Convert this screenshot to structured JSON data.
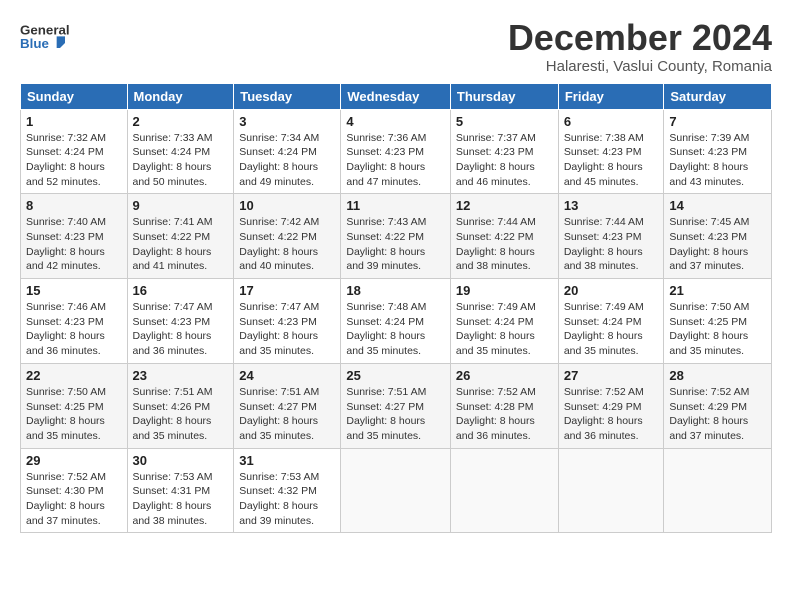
{
  "header": {
    "logo_general": "General",
    "logo_blue": "Blue",
    "month_title": "December 2024",
    "location": "Halaresti, Vaslui County, Romania"
  },
  "weekdays": [
    "Sunday",
    "Monday",
    "Tuesday",
    "Wednesday",
    "Thursday",
    "Friday",
    "Saturday"
  ],
  "weeks": [
    [
      {
        "day": "1",
        "sunrise": "7:32 AM",
        "sunset": "4:24 PM",
        "daylight": "8 hours and 52 minutes."
      },
      {
        "day": "2",
        "sunrise": "7:33 AM",
        "sunset": "4:24 PM",
        "daylight": "8 hours and 50 minutes."
      },
      {
        "day": "3",
        "sunrise": "7:34 AM",
        "sunset": "4:24 PM",
        "daylight": "8 hours and 49 minutes."
      },
      {
        "day": "4",
        "sunrise": "7:36 AM",
        "sunset": "4:23 PM",
        "daylight": "8 hours and 47 minutes."
      },
      {
        "day": "5",
        "sunrise": "7:37 AM",
        "sunset": "4:23 PM",
        "daylight": "8 hours and 46 minutes."
      },
      {
        "day": "6",
        "sunrise": "7:38 AM",
        "sunset": "4:23 PM",
        "daylight": "8 hours and 45 minutes."
      },
      {
        "day": "7",
        "sunrise": "7:39 AM",
        "sunset": "4:23 PM",
        "daylight": "8 hours and 43 minutes."
      }
    ],
    [
      {
        "day": "8",
        "sunrise": "7:40 AM",
        "sunset": "4:23 PM",
        "daylight": "8 hours and 42 minutes."
      },
      {
        "day": "9",
        "sunrise": "7:41 AM",
        "sunset": "4:22 PM",
        "daylight": "8 hours and 41 minutes."
      },
      {
        "day": "10",
        "sunrise": "7:42 AM",
        "sunset": "4:22 PM",
        "daylight": "8 hours and 40 minutes."
      },
      {
        "day": "11",
        "sunrise": "7:43 AM",
        "sunset": "4:22 PM",
        "daylight": "8 hours and 39 minutes."
      },
      {
        "day": "12",
        "sunrise": "7:44 AM",
        "sunset": "4:22 PM",
        "daylight": "8 hours and 38 minutes."
      },
      {
        "day": "13",
        "sunrise": "7:44 AM",
        "sunset": "4:23 PM",
        "daylight": "8 hours and 38 minutes."
      },
      {
        "day": "14",
        "sunrise": "7:45 AM",
        "sunset": "4:23 PM",
        "daylight": "8 hours and 37 minutes."
      }
    ],
    [
      {
        "day": "15",
        "sunrise": "7:46 AM",
        "sunset": "4:23 PM",
        "daylight": "8 hours and 36 minutes."
      },
      {
        "day": "16",
        "sunrise": "7:47 AM",
        "sunset": "4:23 PM",
        "daylight": "8 hours and 36 minutes."
      },
      {
        "day": "17",
        "sunrise": "7:47 AM",
        "sunset": "4:23 PM",
        "daylight": "8 hours and 35 minutes."
      },
      {
        "day": "18",
        "sunrise": "7:48 AM",
        "sunset": "4:24 PM",
        "daylight": "8 hours and 35 minutes."
      },
      {
        "day": "19",
        "sunrise": "7:49 AM",
        "sunset": "4:24 PM",
        "daylight": "8 hours and 35 minutes."
      },
      {
        "day": "20",
        "sunrise": "7:49 AM",
        "sunset": "4:24 PM",
        "daylight": "8 hours and 35 minutes."
      },
      {
        "day": "21",
        "sunrise": "7:50 AM",
        "sunset": "4:25 PM",
        "daylight": "8 hours and 35 minutes."
      }
    ],
    [
      {
        "day": "22",
        "sunrise": "7:50 AM",
        "sunset": "4:25 PM",
        "daylight": "8 hours and 35 minutes."
      },
      {
        "day": "23",
        "sunrise": "7:51 AM",
        "sunset": "4:26 PM",
        "daylight": "8 hours and 35 minutes."
      },
      {
        "day": "24",
        "sunrise": "7:51 AM",
        "sunset": "4:27 PM",
        "daylight": "8 hours and 35 minutes."
      },
      {
        "day": "25",
        "sunrise": "7:51 AM",
        "sunset": "4:27 PM",
        "daylight": "8 hours and 35 minutes."
      },
      {
        "day": "26",
        "sunrise": "7:52 AM",
        "sunset": "4:28 PM",
        "daylight": "8 hours and 36 minutes."
      },
      {
        "day": "27",
        "sunrise": "7:52 AM",
        "sunset": "4:29 PM",
        "daylight": "8 hours and 36 minutes."
      },
      {
        "day": "28",
        "sunrise": "7:52 AM",
        "sunset": "4:29 PM",
        "daylight": "8 hours and 37 minutes."
      }
    ],
    [
      {
        "day": "29",
        "sunrise": "7:52 AM",
        "sunset": "4:30 PM",
        "daylight": "8 hours and 37 minutes."
      },
      {
        "day": "30",
        "sunrise": "7:53 AM",
        "sunset": "4:31 PM",
        "daylight": "8 hours and 38 minutes."
      },
      {
        "day": "31",
        "sunrise": "7:53 AM",
        "sunset": "4:32 PM",
        "daylight": "8 hours and 39 minutes."
      },
      null,
      null,
      null,
      null
    ]
  ],
  "labels": {
    "sunrise": "Sunrise:",
    "sunset": "Sunset:",
    "daylight": "Daylight:"
  }
}
